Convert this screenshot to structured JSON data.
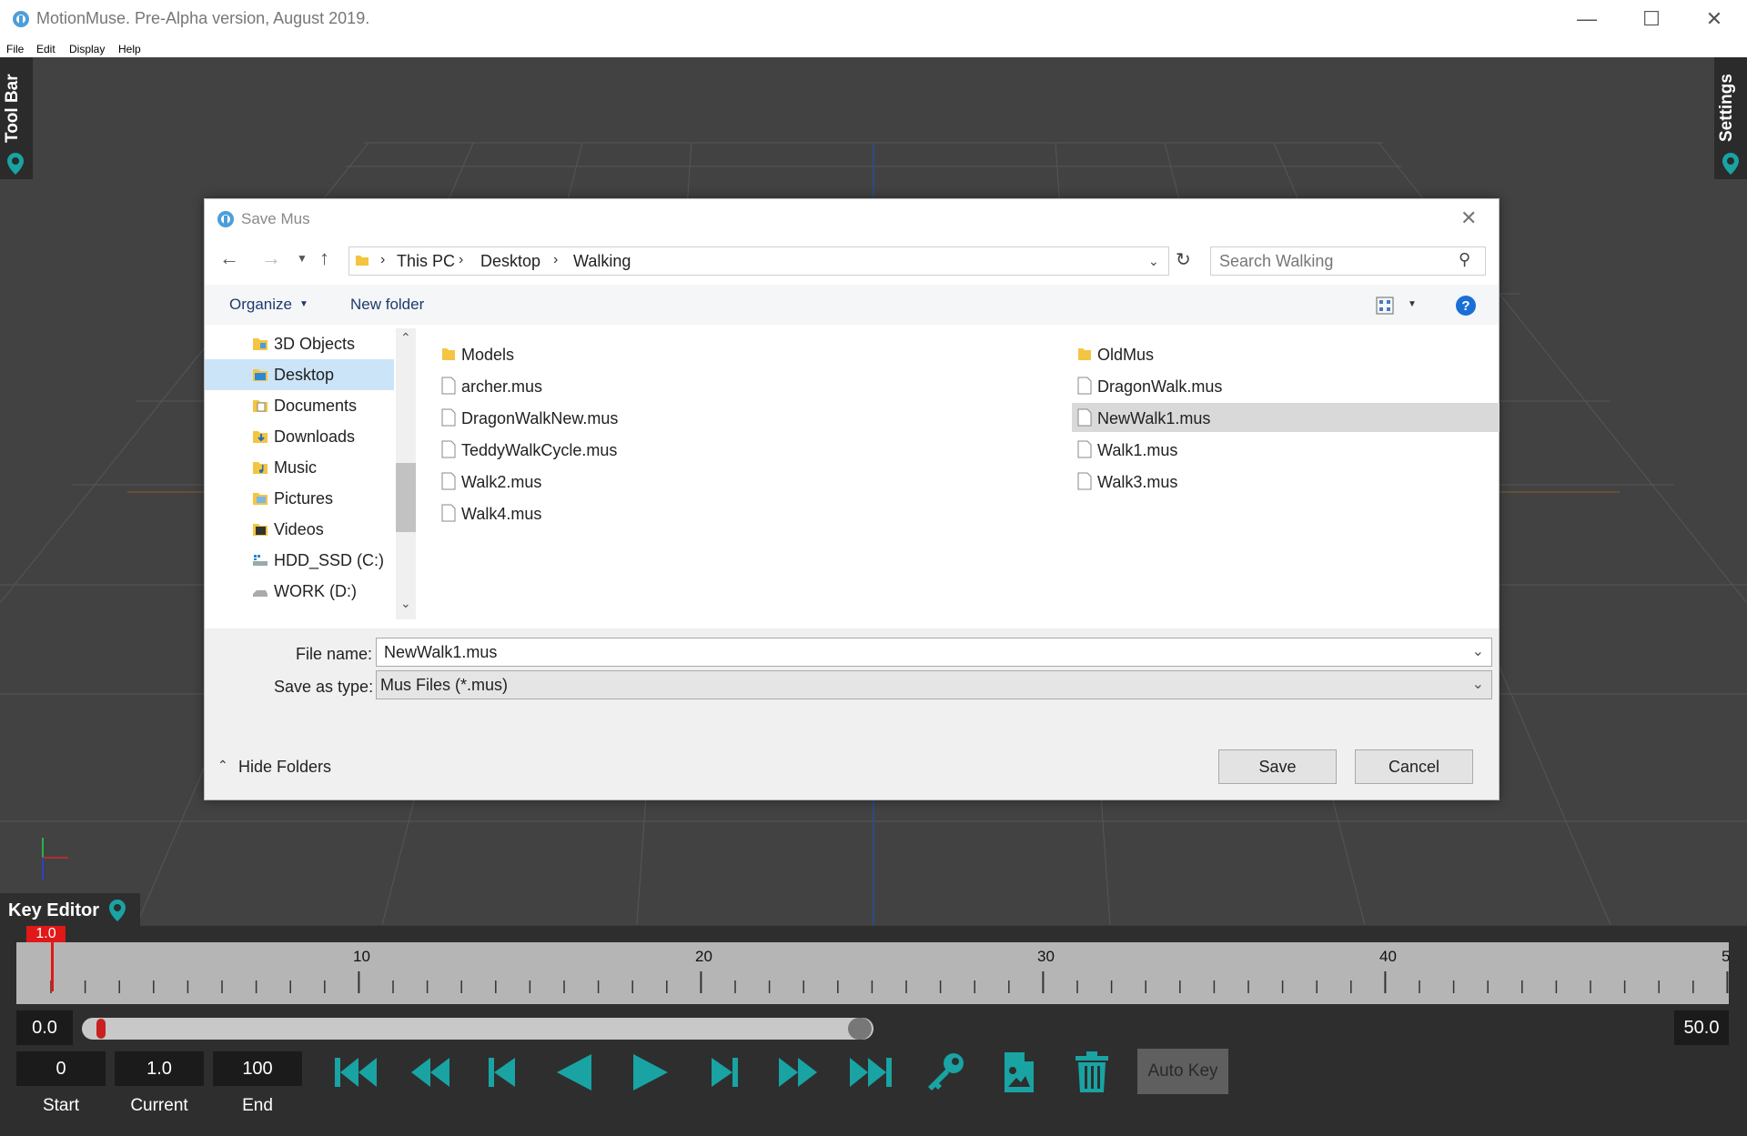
{
  "app": {
    "title": "MotionMuse. Pre-Alpha version, August 2019."
  },
  "menu": [
    "File",
    "Edit",
    "Display",
    "Help"
  ],
  "side_tabs": {
    "left": "Tool Bar",
    "right": "Settings"
  },
  "dialog": {
    "title": "Save Mus",
    "breadcrumb": [
      "This PC",
      "Desktop",
      "Walking"
    ],
    "search_placeholder": "Search Walking",
    "organize": "Organize",
    "new_folder": "New folder",
    "nav_items": [
      "3D Objects",
      "Desktop",
      "Documents",
      "Downloads",
      "Music",
      "Pictures",
      "Videos",
      "HDD_SSD (C:)",
      "WORK (D:)"
    ],
    "nav_selected": "Desktop",
    "files_col1": [
      {
        "name": "Models",
        "type": "folder"
      },
      {
        "name": "archer.mus",
        "type": "file"
      },
      {
        "name": "DragonWalkNew.mus",
        "type": "file"
      },
      {
        "name": "TeddyWalkCycle.mus",
        "type": "file"
      },
      {
        "name": "Walk2.mus",
        "type": "file"
      },
      {
        "name": "Walk4.mus",
        "type": "file"
      }
    ],
    "files_col2": [
      {
        "name": "OldMus",
        "type": "folder"
      },
      {
        "name": "DragonWalk.mus",
        "type": "file"
      },
      {
        "name": "NewWalk1.mus",
        "type": "file"
      },
      {
        "name": "Walk1.mus",
        "type": "file"
      },
      {
        "name": "Walk3.mus",
        "type": "file"
      }
    ],
    "selected_file": "NewWalk1.mus",
    "file_name_label": "File name:",
    "file_name_value": "NewWalk1.mus",
    "save_type_label": "Save as type:",
    "save_type_value": "Mus Files (*.mus)",
    "hide_folders": "Hide Folders",
    "save_button": "Save",
    "cancel_button": "Cancel"
  },
  "key_editor": {
    "title": "Key Editor",
    "playhead_value": "1.0",
    "ruler_labels": [
      "10",
      "20",
      "30",
      "40",
      "5"
    ],
    "range_start": "0.0",
    "range_end": "50.0",
    "start_value": "0",
    "current_value": "1.0",
    "end_value": "100",
    "start_label": "Start",
    "current_label": "Current",
    "end_label": "End",
    "auto_key": "Auto Key",
    "accent_color": "#19a3a3",
    "playhead_color": "#e01818"
  }
}
